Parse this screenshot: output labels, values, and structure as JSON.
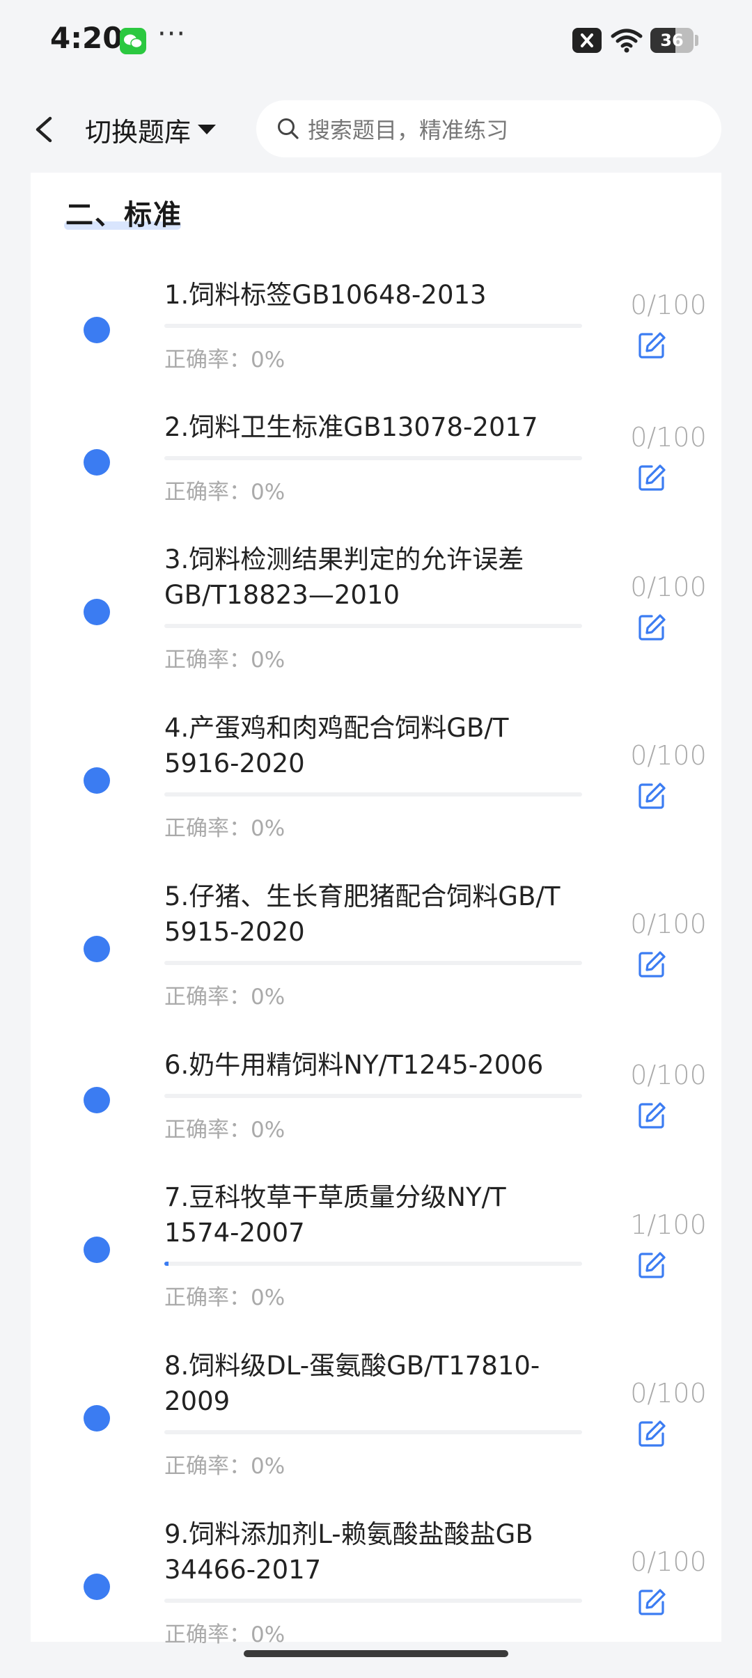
{
  "status_bar": {
    "time": "4:20",
    "dots": "···",
    "battery": "36"
  },
  "header": {
    "switch_label": "切换题库",
    "search_placeholder": "搜索题目，精准练习"
  },
  "section": {
    "title": "二、标准"
  },
  "colors": {
    "accent": "#3b7cf2",
    "muted": "#aaaaaa"
  },
  "items": [
    {
      "title": "1.饲料标签GB10648-2013",
      "count": "0/100",
      "accuracy": "正确率：0%",
      "progress": 0
    },
    {
      "title": "2.饲料卫生标准GB13078-2017",
      "count": "0/100",
      "accuracy": "正确率：0%",
      "progress": 0
    },
    {
      "title": "3.饲料检测结果判定的允许误差GB/T18823—2010",
      "count": "0/100",
      "accuracy": "正确率：0%",
      "progress": 0
    },
    {
      "title": "4.产蛋鸡和肉鸡配合饲料GB/T 5916-2020",
      "count": "0/100",
      "accuracy": "正确率：0%",
      "progress": 0
    },
    {
      "title": "5.仔猪、生长育肥猪配合饲料GB/T 5915-2020",
      "count": "0/100",
      "accuracy": "正确率：0%",
      "progress": 0
    },
    {
      "title": "6.奶牛用精饲料NY/T1245-2006",
      "count": "0/100",
      "accuracy": "正确率：0%",
      "progress": 0
    },
    {
      "title": "7.豆科牧草干草质量分级NY/T 1574-2007",
      "count": "1/100",
      "accuracy": "正确率：0%",
      "progress": 0.01
    },
    {
      "title": "8.饲料级DL-蛋氨酸GB/T17810-2009",
      "count": "0/100",
      "accuracy": "正确率：0%",
      "progress": 0
    },
    {
      "title": "9.饲料添加剂L-赖氨酸盐酸盐GB 34466-2017",
      "count": "0/100",
      "accuracy": "正确率：0%",
      "progress": 0
    }
  ]
}
